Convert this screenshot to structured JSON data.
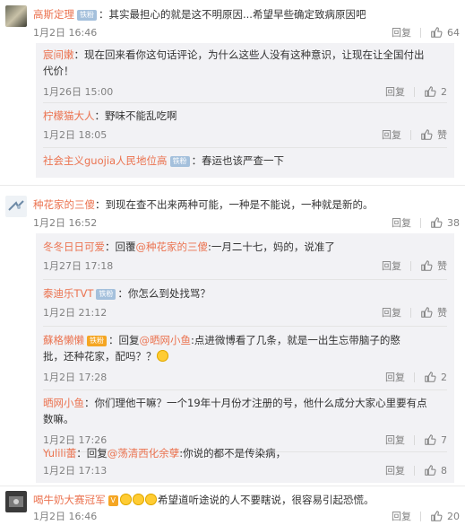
{
  "thread1": {
    "user": "高斯定理",
    "badge": "铁粉",
    "text": "：其实最担心的就是这不明原因...希望早些确定致病原因吧",
    "time": "1月2日 16:46",
    "reply_label": "回复",
    "likes": "64",
    "replies": [
      {
        "user": "宸间嫩",
        "badge": "",
        "text_l1": "：现在回来看你这句话评论，为什么这些人没有这种意识，让现在让全国付出",
        "text_l2": "代价！",
        "time": "1月26日 15:00",
        "reply_label": "回复",
        "likes": "2"
      },
      {
        "user": "柠檬猫大人",
        "badge": "",
        "text_l1": "：野味不能乱吃啊",
        "text_l2": "",
        "time": "1月2日 18:05",
        "reply_label": "回复",
        "likes": "赞"
      },
      {
        "user": "社会主义guojia人民地位高",
        "badge": "铁粉",
        "text_l1": "：春运也该严查一下",
        "text_l2": "",
        "time": "",
        "reply_label": "",
        "likes": ""
      }
    ]
  },
  "thread2": {
    "user": "种花家的三傻",
    "badge": "",
    "text": "：到现在查不出来两种可能，一种是不能说，一种就是新的。",
    "time": "1月2日 16:52",
    "reply_label": "回复",
    "likes": "38",
    "replies": [
      {
        "user": "冬冬日日可爱",
        "pre": "：回覆",
        "mention": "@种花家的三傻",
        "text_l1": ":一月二十七，妈的，说准了",
        "time": "1月27日 17:18",
        "reply_label": "回复",
        "likes": "赞"
      },
      {
        "user": "泰迪乐TVT",
        "badge": "铁粉",
        "text_l1": "：你怎么到处找骂？",
        "time": "1月2日 21:12",
        "reply_label": "回复",
        "likes": "赞"
      },
      {
        "user": "蘇格懒懒",
        "badge": "铁粉",
        "pre": "：回复",
        "mention": "@晒网小鱼",
        "text_l1": ":点进微博看了几条，就是一出生忘带脑子的愍",
        "text_l2": "批，还种花家，配吗？？",
        "time": "1月2日 17:28",
        "reply_label": "回复",
        "likes": "2"
      },
      {
        "user": "晒网小鱼",
        "text_l1": "：你们理他干嘛？一个19年十月份才注册的号，他什么成分大家心里要有点",
        "text_l2": "数嘛。",
        "time": "1月2日 17:26",
        "reply_label": "回复",
        "likes": "7"
      },
      {
        "user": "Yulili蕾",
        "pre": "：回复",
        "mention": "@荡清西化余孽",
        "text_l1": ":你说的都不是传染病，",
        "time": "1月2日 17:13",
        "reply_label": "回复",
        "likes": "8"
      }
    ]
  },
  "thread3": {
    "user": "喝牛奶大赛冠军",
    "badge": "V",
    "text": "希望道听途说的人不要瞎说，很容易引起恐慌。",
    "time": "1月2日 16:46",
    "reply_label": "回复",
    "likes": "20"
  },
  "colors": {
    "username": "#eb7350",
    "link": "#eb7350",
    "muted": "#808080",
    "subbg": "#f2f2f5"
  }
}
